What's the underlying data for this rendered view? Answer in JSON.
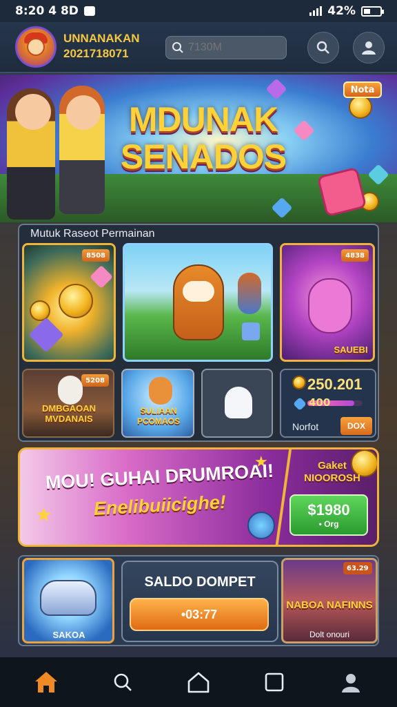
{
  "status_bar": {
    "time": "8:20 4 8D",
    "battery_text": "42%",
    "battery_level": 0.42
  },
  "header": {
    "user_name": "UNNANAKAN",
    "user_id": "2021718071",
    "search_placeholder": "7130M",
    "accent_color": "#f7c843"
  },
  "hero": {
    "title_line1": "MDUNAK",
    "title_line2": "SENADOS",
    "badge": "Nota"
  },
  "section": {
    "title": "Mutuk Raseot Permainan",
    "cards": [
      {
        "tag": "8508",
        "label": ""
      },
      {
        "tag": "",
        "label": ""
      },
      {
        "tag": "4838",
        "label": "SAUEBI"
      }
    ],
    "small_cards": [
      {
        "tag": "5208",
        "label": "DMBGAOAN MVDANAIS"
      },
      {
        "tag": "",
        "label": "SULIAAN PCOMAOS"
      },
      {
        "tag": "",
        "label": ""
      }
    ],
    "wallet_card": {
      "value": "250.201",
      "bar_value": "400",
      "bar_level": 0.85,
      "label": "Norfot",
      "button": "DOX"
    }
  },
  "promo": {
    "line1": "MOU! GUHAI DRUMROAI!",
    "line2": "Enelibuiicighe!",
    "right_title": "Gaket NIOOROSH",
    "amount": "$1980",
    "amount_sub": "• Org"
  },
  "bottom": {
    "car_label": "SAKOA",
    "wallet_title": "SALDO DOMPET",
    "wallet_button": "•03:77",
    "game_title": "NABOA NAFINNS",
    "game_tag": "63.29",
    "game_foot": "Dolt onouri"
  },
  "nav": {
    "items": [
      {
        "icon": "home-icon"
      },
      {
        "icon": "search-icon"
      },
      {
        "icon": "home-outline-icon"
      },
      {
        "icon": "square-icon"
      },
      {
        "icon": "profile-icon"
      }
    ]
  }
}
